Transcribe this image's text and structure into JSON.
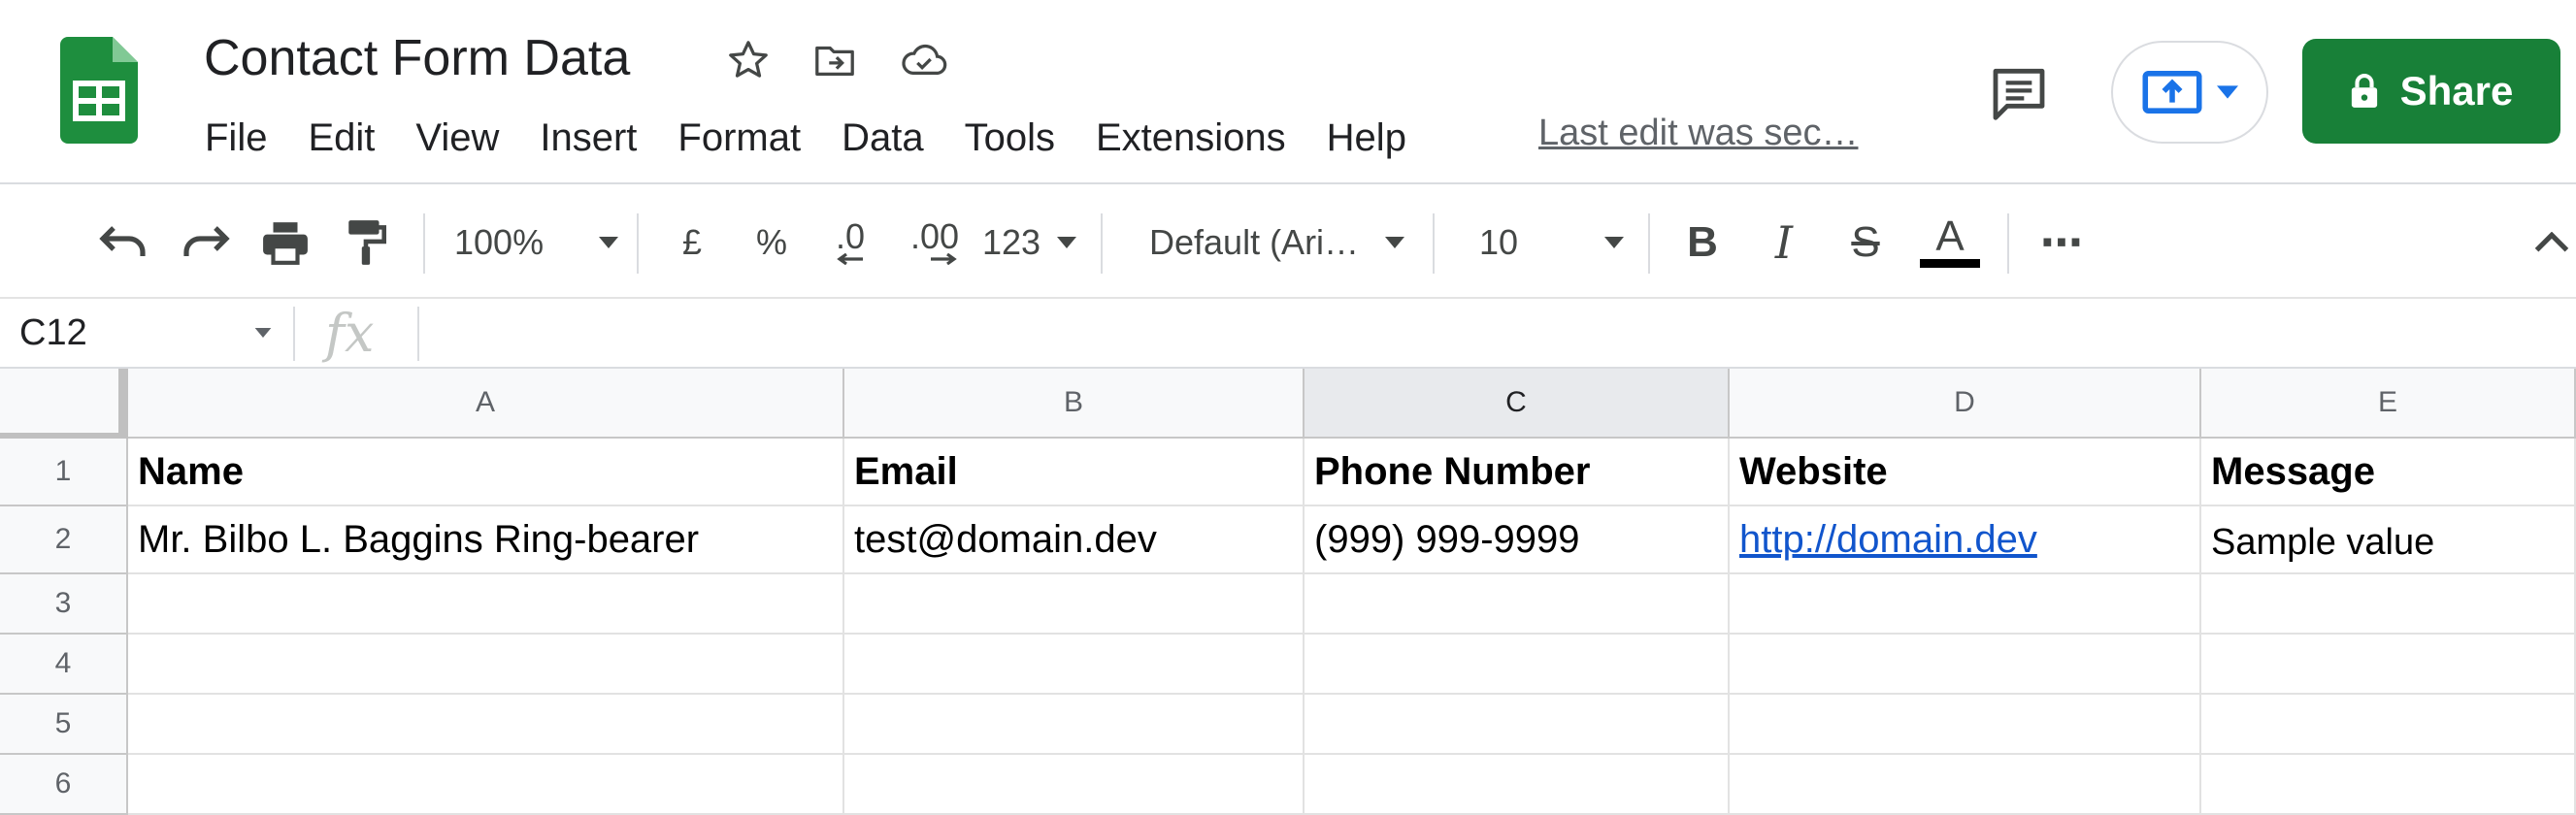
{
  "doc": {
    "title": "Contact Form Data",
    "last_edit": "Last edit was sec…"
  },
  "menu": [
    "File",
    "Edit",
    "View",
    "Insert",
    "Format",
    "Data",
    "Tools",
    "Extensions",
    "Help"
  ],
  "header": {
    "share_label": "Share",
    "icons": [
      "star-icon",
      "move-to-folder-icon",
      "cloud-saved-icon",
      "comment-icon",
      "present-icon",
      "lock-icon"
    ]
  },
  "toolbar": {
    "zoom": "100%",
    "currency": "£",
    "percent": "%",
    "decrease_decimal": ".0",
    "increase_decimal": ".00",
    "more_formats": "123",
    "font": "Default (Ari…",
    "font_size": "10",
    "bold": "B",
    "italic": "I",
    "strikethrough": "S",
    "text_color": "A",
    "more": "⋯"
  },
  "formula_bar": {
    "cell_ref": "C12",
    "fx": "fx",
    "value": ""
  },
  "grid": {
    "columns": [
      "A",
      "B",
      "C",
      "D",
      "E"
    ],
    "active_column": "C",
    "row_numbers": [
      "1",
      "2",
      "3",
      "4",
      "5",
      "6"
    ],
    "header_row": [
      "Name",
      "Email",
      "Phone Number",
      "Website",
      "Message"
    ],
    "data_rows": [
      [
        "Mr. Bilbo L. Baggins Ring-bearer",
        "test@domain.dev",
        "(999) 999-9999",
        "http://domain.dev",
        "Sample value"
      ]
    ]
  },
  "colors": {
    "brand_green": "#188038",
    "sheets_logo": "#1e8e3e",
    "link": "#1155cc",
    "present_blue": "#1a73e8"
  }
}
